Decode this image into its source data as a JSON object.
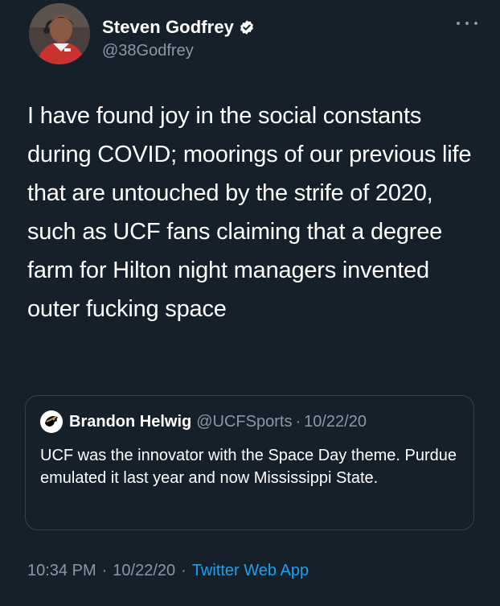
{
  "tweet": {
    "author": {
      "display_name": "Steven Godfrey",
      "handle": "@38Godfrey",
      "verified": true
    },
    "text": "I have found joy in the social constants during COVID; moorings of our previous life that are untouched by the strife of 2020, such as UCF fans claiming that a degree farm for Hilton night managers invented outer fucking space",
    "quoted_tweet": {
      "author_name": "Brandon Helwig",
      "author_handle": "@UCFSports",
      "separator": "·",
      "date": "10/22/20",
      "text": "UCF was the innovator with the Space Day theme. Purdue emulated it last year and now Mississippi State."
    },
    "meta": {
      "time": "10:34 PM",
      "separator": "·",
      "date": "10/22/20",
      "source": "Twitter Web App"
    }
  },
  "icons": {
    "verified": "verified-badge-icon",
    "more": "more-options-icon"
  },
  "colors": {
    "background": "#15202b",
    "secondary_text": "#8899a6",
    "link": "#1da1f2",
    "border": "#38444d"
  }
}
